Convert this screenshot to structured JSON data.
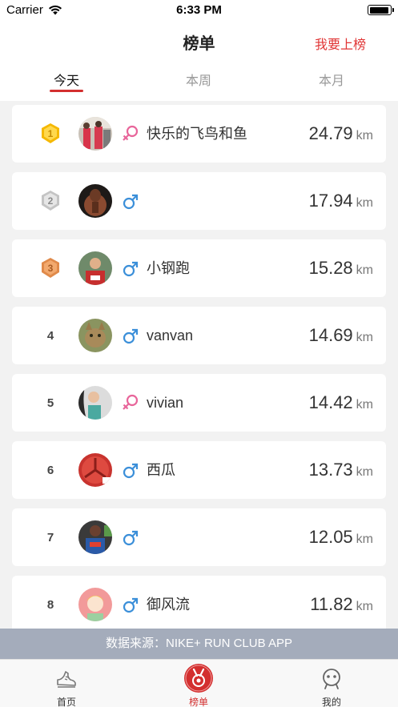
{
  "status_bar": {
    "carrier": "Carrier",
    "time": "6:33 PM"
  },
  "nav": {
    "title": "榜单",
    "action": "我要上榜"
  },
  "tabs": [
    {
      "label": "今天",
      "active": true
    },
    {
      "label": "本周",
      "active": false
    },
    {
      "label": "本月",
      "active": false
    }
  ],
  "rows": [
    {
      "rank": "1",
      "medal": "gold",
      "gender": "female",
      "name": "快乐的飞鸟和鱼",
      "distance": "24.79",
      "unit": "km"
    },
    {
      "rank": "2",
      "medal": "silver",
      "gender": "male",
      "name": "",
      "distance": "17.94",
      "unit": "km"
    },
    {
      "rank": "3",
      "medal": "bronze",
      "gender": "male",
      "name": "小钢跑",
      "distance": "15.28",
      "unit": "km"
    },
    {
      "rank": "4",
      "medal": "",
      "gender": "male",
      "name": "vanvan",
      "distance": "14.69",
      "unit": "km"
    },
    {
      "rank": "5",
      "medal": "",
      "gender": "female",
      "name": "vivian",
      "distance": "14.42",
      "unit": "km"
    },
    {
      "rank": "6",
      "medal": "",
      "gender": "male",
      "name": "西瓜",
      "distance": "13.73",
      "unit": "km"
    },
    {
      "rank": "7",
      "medal": "",
      "gender": "male",
      "name": "",
      "distance": "12.05",
      "unit": "km"
    },
    {
      "rank": "8",
      "medal": "",
      "gender": "male",
      "name": "御风流",
      "distance": "11.82",
      "unit": "km"
    }
  ],
  "source": "数据来源：NIKE+ RUN CLUB APP",
  "tabbar": [
    {
      "label": "首页",
      "icon": "shoe-icon",
      "active": false
    },
    {
      "label": "榜单",
      "icon": "medal-icon",
      "active": true
    },
    {
      "label": "我的",
      "icon": "face-icon",
      "active": false
    }
  ],
  "colors": {
    "accent": "#d32f2f",
    "male": "#3b8fd9",
    "female": "#e8659a",
    "gold": "#f5b800",
    "silver": "#b5b5b5",
    "bronze": "#e08a4a"
  }
}
